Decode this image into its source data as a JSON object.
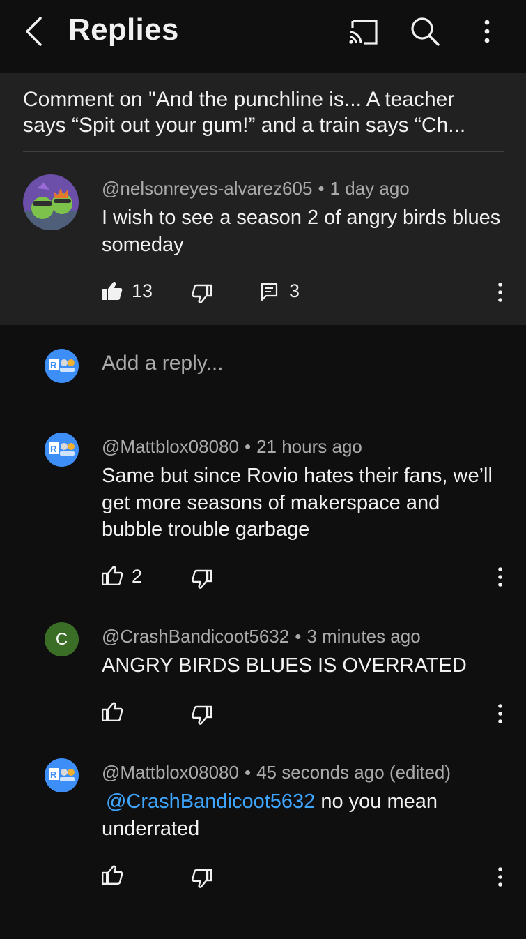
{
  "header": {
    "title": "Replies",
    "back_icon": "chevron-left-icon",
    "cast_icon": "cast-icon",
    "search_icon": "search-icon",
    "more_icon": "more-vertical-icon"
  },
  "context": {
    "text": "Comment on \"And the punchline is... A teacher\nsays “Spit out your gum!” and a train says “Ch..."
  },
  "parent_comment": {
    "author": "@nelsonreyes-alvarez605",
    "time": "1 day ago",
    "text": "I wish to see a season 2 of angry birds blues someday",
    "likes": "13",
    "replies": "3",
    "liked": true
  },
  "add_reply": {
    "placeholder": "Add a reply..."
  },
  "replies": [
    {
      "author": "@Mattblox08080",
      "time": "21 hours ago",
      "text": "Same but since Rovio hates their fans, we’ll get more seasons of makerspace and bubble trouble garbage",
      "likes": "2"
    },
    {
      "author": "@CrashBandicoot5632",
      "time": "3 minutes ago",
      "text": "ANGRY BIRDS BLUES IS OVERRATED",
      "avatar_letter": "C",
      "likes": ""
    },
    {
      "author": "@Mattblox08080",
      "time": "45 seconds ago (edited)",
      "mention": "@CrashBandicoot5632",
      "text": " no you mean underrated",
      "likes": ""
    }
  ],
  "colors": {
    "background": "#0f0f0f",
    "panel": "#212121",
    "mention": "#3ea6ff",
    "secondary_text": "#aaaaaa"
  }
}
